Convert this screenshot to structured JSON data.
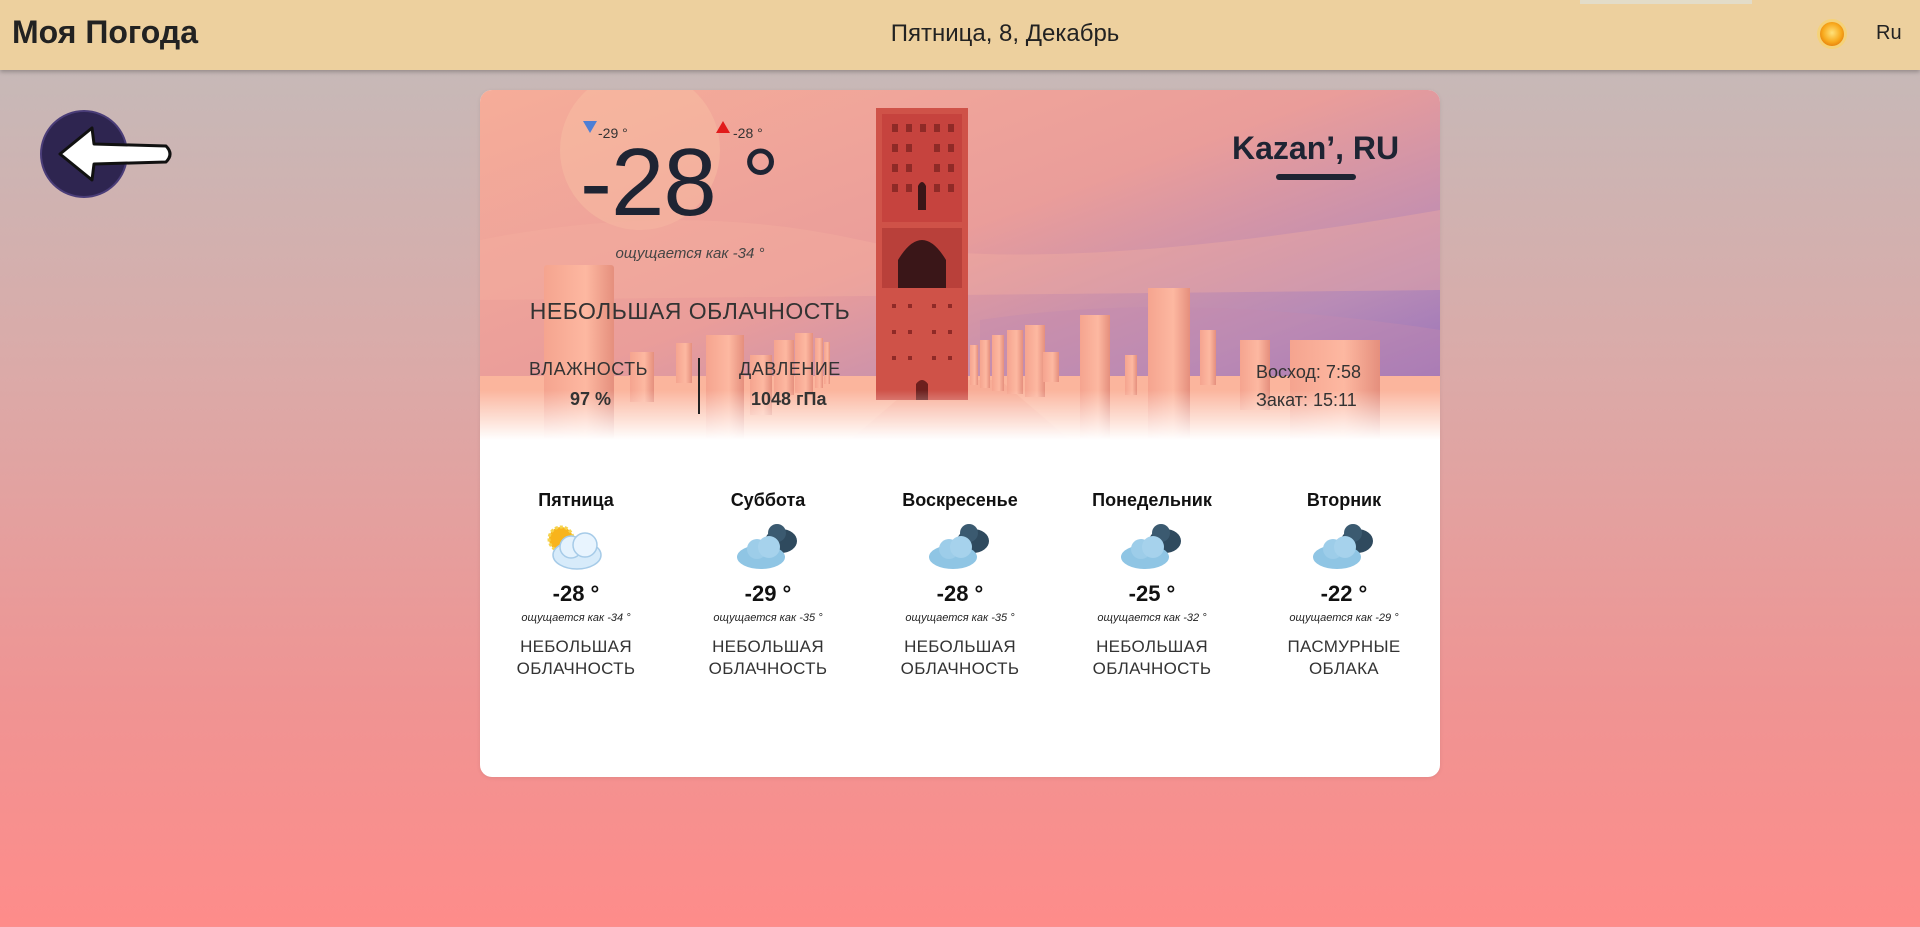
{
  "header": {
    "app_title": "Моя Погода",
    "date": "Пятница, 8, Декабрь",
    "theme_icon": "sun-icon",
    "language": "Ru"
  },
  "back": {
    "icon": "arrow-left-icon"
  },
  "current": {
    "temp": "-28 °",
    "min": "-29 °",
    "max": "-28 °",
    "feels": "ощущается как -34 °",
    "condition": "НЕБОЛЬШАЯ ОБЛАЧНОСТЬ",
    "humidity_label": "ВЛАЖНОСТЬ",
    "humidity_value": "97 %",
    "pressure_label": "ДАВЛЕНИЕ",
    "pressure_value": "1048 гПа",
    "city": "Kazan’, RU",
    "sunrise": "Восход: 7:58",
    "sunset": "Закат: 15:11"
  },
  "colors": {
    "header_bg": "#edd09e",
    "min_arrow": "#4d7fd6",
    "max_arrow": "#e11b1b",
    "back_button": "#2e2550"
  },
  "forecast": [
    {
      "day": "Пятница",
      "icon": "partly-cloudy-icon",
      "temp": "-28 °",
      "feels": "ощущается как -34 °",
      "condition": "НЕБОЛЬШАЯ ОБЛАЧНОСТЬ"
    },
    {
      "day": "Суббота",
      "icon": "clouds-icon",
      "temp": "-29 °",
      "feels": "ощущается как -35 °",
      "condition": "НЕБОЛЬШАЯ ОБЛАЧНОСТЬ"
    },
    {
      "day": "Воскресенье",
      "icon": "clouds-icon",
      "temp": "-28 °",
      "feels": "ощущается как -35 °",
      "condition": "НЕБОЛЬШАЯ ОБЛАЧНОСТЬ"
    },
    {
      "day": "Понедельник",
      "icon": "clouds-icon",
      "temp": "-25 °",
      "feels": "ощущается как -32 °",
      "condition": "НЕБОЛЬШАЯ ОБЛАЧНОСТЬ"
    },
    {
      "day": "Вторник",
      "icon": "clouds-icon",
      "temp": "-22 °",
      "feels": "ощущается как -29 °",
      "condition": "ПАСМУРНЫЕ ОБЛАКА"
    }
  ]
}
